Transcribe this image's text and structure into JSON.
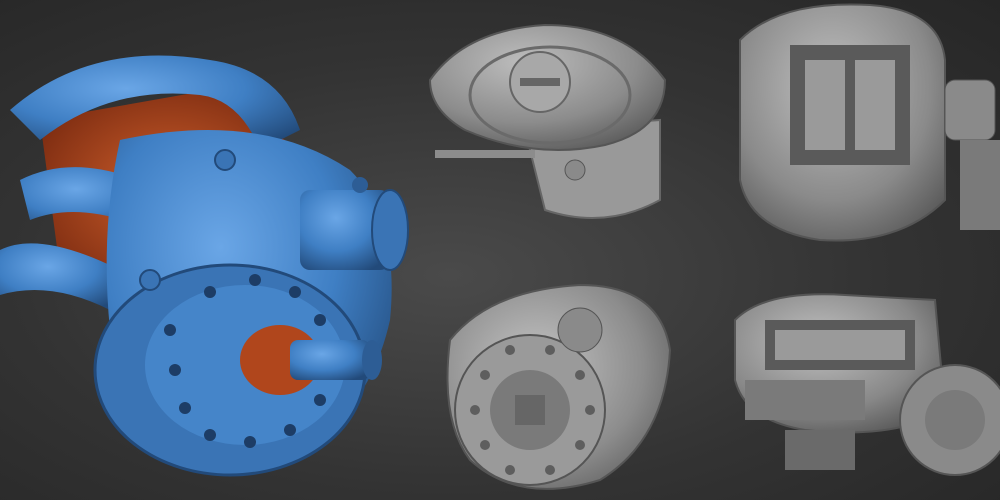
{
  "scene": {
    "background": "#333333",
    "views": [
      {
        "id": "main",
        "render": "blue-scan",
        "colors": {
          "primary": "#3f7fc4",
          "interior": "#b0461c"
        }
      },
      {
        "id": "top-left-small",
        "render": "grey-scan",
        "colors": {
          "primary": "#8c8c8c"
        }
      },
      {
        "id": "top-right-small",
        "render": "grey-scan",
        "colors": {
          "primary": "#8c8c8c"
        }
      },
      {
        "id": "bottom-left-small",
        "render": "grey-scan",
        "colors": {
          "primary": "#8c8c8c"
        }
      },
      {
        "id": "bottom-right-small",
        "render": "grey-scan",
        "colors": {
          "primary": "#8c8c8c"
        }
      }
    ]
  }
}
